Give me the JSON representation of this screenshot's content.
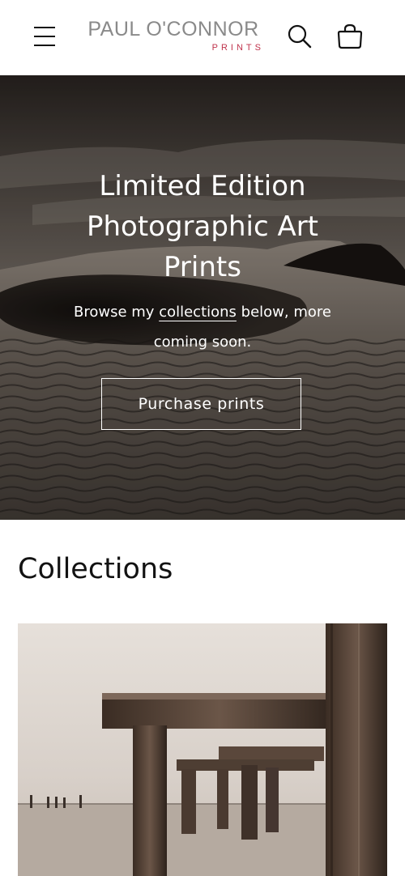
{
  "header": {
    "logo_name": "PAUL O'CONNOR",
    "logo_sub": "PRINTS",
    "icons": {
      "menu": "hamburger-menu-icon",
      "search": "search-icon",
      "cart": "cart-bag-icon"
    }
  },
  "hero": {
    "title_lines": [
      "Limited Edition",
      "Photographic Art",
      "Prints"
    ],
    "subtitle_before": "Browse my ",
    "subtitle_link": "collections",
    "subtitle_after_line1": " below, more",
    "subtitle_line2": "coming soon.",
    "button_label": "Purchase prints"
  },
  "collections": {
    "heading": "Collections"
  },
  "colors": {
    "logo_gray": "#8a8a8a",
    "logo_accent": "#c0344d",
    "text": "#121212",
    "hero_text": "#ffffff"
  }
}
